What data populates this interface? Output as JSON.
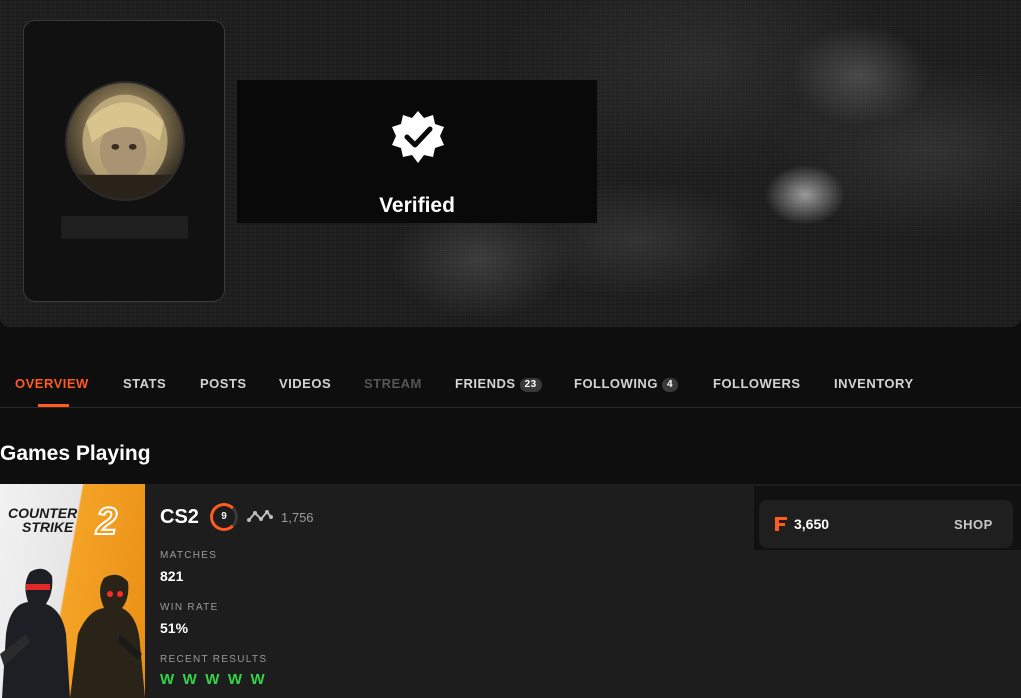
{
  "profile": {
    "verified_label": "Verified"
  },
  "tabs": [
    {
      "label": "OVERVIEW",
      "state": "active"
    },
    {
      "label": "STATS",
      "state": "normal"
    },
    {
      "label": "POSTS",
      "state": "normal"
    },
    {
      "label": "VIDEOS",
      "state": "normal"
    },
    {
      "label": "STREAM",
      "state": "disabled"
    },
    {
      "label": "FRIENDS",
      "state": "normal",
      "count": "23"
    },
    {
      "label": "FOLLOWING",
      "state": "normal",
      "count": "4"
    },
    {
      "label": "FOLLOWERS",
      "state": "normal"
    },
    {
      "label": "INVENTORY",
      "state": "normal"
    }
  ],
  "games_section": {
    "title": "Games Playing"
  },
  "game": {
    "cover_title_line1": "COUNTER",
    "cover_title_line2": "STRIKE",
    "cover_number": "2",
    "name": "CS2",
    "level": "9",
    "elo": "1,756",
    "matches_label": "MATCHES",
    "matches_value": "821",
    "win_rate_label": "WIN RATE",
    "win_rate_value": "51%",
    "recent_results_label": "RECENT RESULTS",
    "recent_results": [
      "W",
      "W",
      "W",
      "W",
      "W"
    ]
  },
  "shop": {
    "points": "3,650",
    "button_label": "SHOP"
  },
  "colors": {
    "accent": "#ff5a1f",
    "win": "#33d44a",
    "background": "#0e0e0e",
    "card": "#1d1d1d"
  }
}
